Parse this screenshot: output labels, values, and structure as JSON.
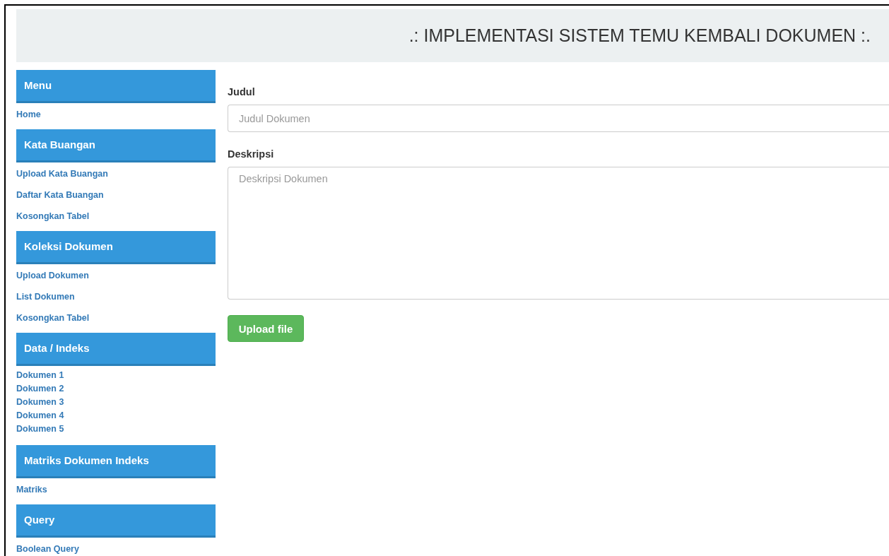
{
  "header": {
    "title": ".: IMPLEMENTASI SISTEM TEMU KEMBALI DOKUMEN :."
  },
  "sidebar": {
    "sections": [
      {
        "title": "Menu",
        "kind": "spaced",
        "items": [
          "Home"
        ]
      },
      {
        "title": "Kata Buangan",
        "kind": "spaced",
        "items": [
          "Upload Kata Buangan",
          "Daftar Kata Buangan",
          "Kosongkan Tabel"
        ]
      },
      {
        "title": "Koleksi Dokumen",
        "kind": "spaced",
        "items": [
          "Upload Dokumen",
          "List Dokumen",
          "Kosongkan Tabel"
        ]
      },
      {
        "title": "Data / Indeks",
        "kind": "compact",
        "items": [
          "Dokumen 1",
          "Dokumen 2",
          "Dokumen 3",
          "Dokumen 4",
          "Dokumen 5"
        ]
      },
      {
        "title": "Matriks Dokumen Indeks",
        "kind": "spaced",
        "items": [
          "Matriks"
        ]
      },
      {
        "title": "Query",
        "kind": "spaced",
        "items": [
          "Boolean Query"
        ]
      }
    ]
  },
  "form": {
    "fields": [
      {
        "label": "Judul",
        "kind": "input",
        "placeholder": "Judul Dokumen"
      },
      {
        "label": "Deskripsi",
        "kind": "textarea",
        "placeholder": "Deskripsi Dokumen"
      }
    ],
    "button": "Upload file"
  }
}
